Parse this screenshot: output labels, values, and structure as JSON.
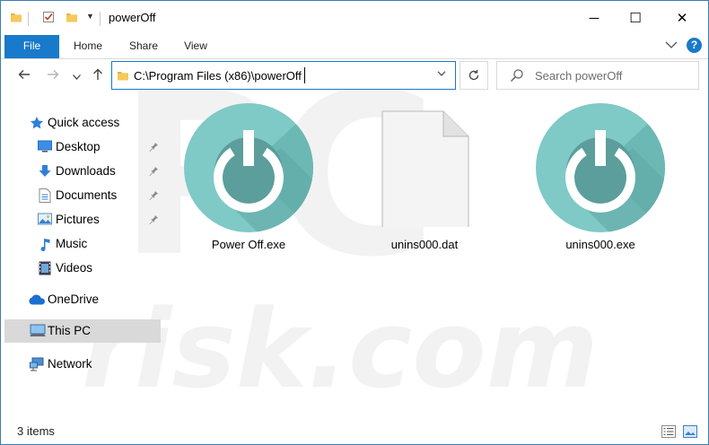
{
  "window": {
    "title": "powerOff",
    "controls": {
      "minimize": "─",
      "maximize": "☐",
      "close": "✕"
    }
  },
  "ribbon": {
    "tabs": [
      {
        "label": "File",
        "active": true
      },
      {
        "label": "Home"
      },
      {
        "label": "Share"
      },
      {
        "label": "View"
      }
    ],
    "help_label": "?"
  },
  "address_bar": {
    "path": "C:\\Program Files (x86)\\powerOff"
  },
  "search": {
    "placeholder": "Search powerOff"
  },
  "nav": {
    "items": [
      {
        "label": "Quick access",
        "icon": "star-icon",
        "pinned": false
      },
      {
        "label": "Desktop",
        "icon": "desktop-icon",
        "pinned": true
      },
      {
        "label": "Downloads",
        "icon": "download-icon",
        "pinned": true
      },
      {
        "label": "Documents",
        "icon": "document-icon",
        "pinned": true
      },
      {
        "label": "Pictures",
        "icon": "pictures-icon",
        "pinned": true
      },
      {
        "label": "Music",
        "icon": "music-icon",
        "pinned": false
      },
      {
        "label": "Videos",
        "icon": "video-icon",
        "pinned": false
      },
      {
        "label": "OneDrive",
        "icon": "cloud-icon",
        "pinned": false
      },
      {
        "label": "This PC",
        "icon": "computer-icon",
        "selected": true
      },
      {
        "label": "Network",
        "icon": "network-icon",
        "pinned": false
      }
    ]
  },
  "files": [
    {
      "name": "Power Off.exe",
      "icon": "power-icon"
    },
    {
      "name": "unins000.dat",
      "icon": "blank-file-icon"
    },
    {
      "name": "unins000.exe",
      "icon": "power-icon"
    }
  ],
  "status": {
    "item_count": "3 items"
  },
  "watermark": {
    "line1": "PC",
    "line2": "risk.com"
  },
  "colors": {
    "accent": "#1979ca",
    "power_light": "#7fc9c6",
    "power_dark": "#5a9e9b",
    "selection": "#d9d9d9"
  }
}
